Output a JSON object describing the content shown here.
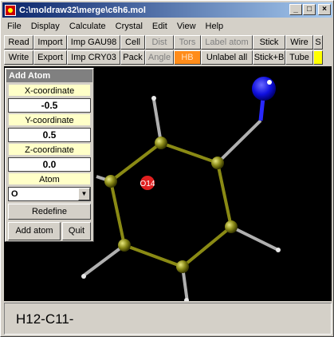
{
  "window": {
    "title": "C:\\moldraw32\\merge\\c6h6.mol",
    "minimize": "_",
    "maximize": "□",
    "close": "×"
  },
  "menu": [
    "File",
    "Display",
    "Calculate",
    "Crystal",
    "Edit",
    "View",
    "Help"
  ],
  "toolbar": {
    "row1": [
      {
        "label": "Read",
        "state": "normal"
      },
      {
        "label": "Import",
        "state": "normal"
      },
      {
        "label": "Imp GAU98",
        "state": "normal"
      },
      {
        "label": "Cell",
        "state": "normal"
      },
      {
        "label": "Dist",
        "state": "disabled"
      },
      {
        "label": "Tors",
        "state": "disabled"
      },
      {
        "label": "Label atom",
        "state": "disabled"
      },
      {
        "label": "Stick",
        "state": "normal"
      },
      {
        "label": "Wire",
        "state": "normal"
      },
      {
        "label": "S",
        "state": "normal"
      }
    ],
    "row2": [
      {
        "label": "Write",
        "state": "normal"
      },
      {
        "label": "Export",
        "state": "normal"
      },
      {
        "label": "Imp CRY03",
        "state": "normal"
      },
      {
        "label": "Pack",
        "state": "normal"
      },
      {
        "label": "Angle",
        "state": "disabled"
      },
      {
        "label": "HB",
        "state": "orange"
      },
      {
        "label": "Unlabel all",
        "state": "normal"
      },
      {
        "label": "Stick+B",
        "state": "normal"
      },
      {
        "label": "Tube",
        "state": "normal"
      },
      {
        "label": "",
        "state": "yellow"
      }
    ]
  },
  "add_atom_panel": {
    "title": "Add Atom",
    "x_label": "X-coordinate",
    "x_value": "-0.5",
    "y_label": "Y-coordinate",
    "y_value": "0.5",
    "z_label": "Z-coordinate",
    "z_value": "0.0",
    "atom_label": "Atom",
    "atom_value": "O",
    "redefine": "Redefine",
    "add_atom": "Add atom",
    "quit": "Quit"
  },
  "viewport": {
    "marker_label": "O14",
    "colors": {
      "background": "#000000",
      "carbon": "#7a7a10",
      "hydrogen": "#e8e8e8",
      "oxygen": "#1010e0",
      "marker": "#e02020"
    }
  },
  "status": {
    "text": "H12-C11-"
  }
}
